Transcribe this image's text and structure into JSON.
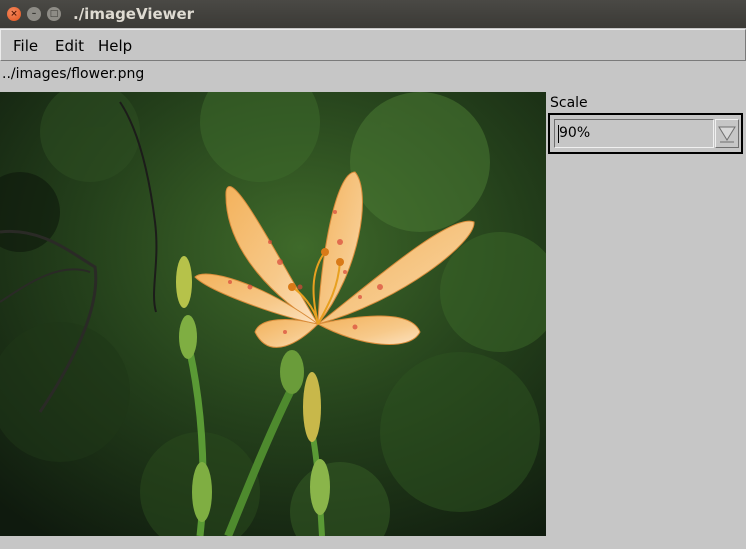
{
  "window": {
    "title": "./imageViewer"
  },
  "menu": {
    "file": "File",
    "edit": "Edit",
    "help": "Help"
  },
  "image": {
    "path": "../images/flower.png"
  },
  "scale": {
    "label": "Scale",
    "value": "90%"
  },
  "icons": {
    "close": "close-icon",
    "minimize": "minimize-icon",
    "maximize": "maximize-icon",
    "dropdown": "triangle-down-icon"
  }
}
